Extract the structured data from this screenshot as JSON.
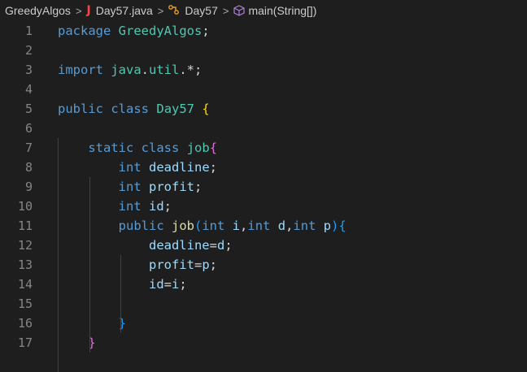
{
  "breadcrumb": {
    "items": [
      {
        "label": "GreedyAlgos",
        "icon": null
      },
      {
        "label": "Day57.java",
        "icon": "java-file-icon"
      },
      {
        "label": "Day57",
        "icon": "class-icon"
      },
      {
        "label": "main(String[])",
        "icon": "method-icon"
      }
    ],
    "separator": ">"
  },
  "colors": {
    "background": "#1e1e1e",
    "keyword": "#569cd6",
    "type": "#4ec9b0",
    "variable": "#9cdcfe",
    "function": "#dcdcaa",
    "bracket_gold": "#ffd700",
    "bracket_purple": "#da70d6",
    "bracket_blue": "#179fff"
  },
  "code": {
    "lines": [
      {
        "n": "1",
        "tokens": [
          [
            "kw",
            "package"
          ],
          [
            "pn",
            " "
          ],
          [
            "ty",
            "GreedyAlgos"
          ],
          [
            "pn",
            ";"
          ]
        ]
      },
      {
        "n": "2",
        "tokens": []
      },
      {
        "n": "3",
        "tokens": [
          [
            "kw",
            "import"
          ],
          [
            "pn",
            " "
          ],
          [
            "ty",
            "java"
          ],
          [
            "pn",
            "."
          ],
          [
            "ty",
            "util"
          ],
          [
            "pn",
            ".*;"
          ]
        ]
      },
      {
        "n": "4",
        "tokens": []
      },
      {
        "n": "5",
        "tokens": [
          [
            "kw",
            "public"
          ],
          [
            "pn",
            " "
          ],
          [
            "kw",
            "class"
          ],
          [
            "pn",
            " "
          ],
          [
            "ty",
            "Day57"
          ],
          [
            "pn",
            " "
          ],
          [
            "b1",
            "{"
          ]
        ]
      },
      {
        "n": "6",
        "tokens": []
      },
      {
        "n": "7",
        "tokens": [
          [
            "pn",
            "    "
          ],
          [
            "kw",
            "static"
          ],
          [
            "pn",
            " "
          ],
          [
            "kw",
            "class"
          ],
          [
            "pn",
            " "
          ],
          [
            "ty",
            "job"
          ],
          [
            "b2",
            "{"
          ]
        ]
      },
      {
        "n": "8",
        "tokens": [
          [
            "pn",
            "        "
          ],
          [
            "kw",
            "int"
          ],
          [
            "pn",
            " "
          ],
          [
            "id",
            "deadline"
          ],
          [
            "pn",
            ";"
          ]
        ]
      },
      {
        "n": "9",
        "tokens": [
          [
            "pn",
            "        "
          ],
          [
            "kw",
            "int"
          ],
          [
            "pn",
            " "
          ],
          [
            "id",
            "profit"
          ],
          [
            "pn",
            ";"
          ]
        ]
      },
      {
        "n": "10",
        "tokens": [
          [
            "pn",
            "        "
          ],
          [
            "kw",
            "int"
          ],
          [
            "pn",
            " "
          ],
          [
            "id",
            "id"
          ],
          [
            "pn",
            ";"
          ]
        ]
      },
      {
        "n": "11",
        "tokens": [
          [
            "pn",
            "        "
          ],
          [
            "kw",
            "public"
          ],
          [
            "pn",
            " "
          ],
          [
            "fn",
            "job"
          ],
          [
            "b3",
            "("
          ],
          [
            "kw",
            "int"
          ],
          [
            "pn",
            " "
          ],
          [
            "id",
            "i"
          ],
          [
            "pn",
            ","
          ],
          [
            "kw",
            "int"
          ],
          [
            "pn",
            " "
          ],
          [
            "id",
            "d"
          ],
          [
            "pn",
            ","
          ],
          [
            "kw",
            "int"
          ],
          [
            "pn",
            " "
          ],
          [
            "id",
            "p"
          ],
          [
            "b3",
            ")"
          ],
          [
            "b3",
            "{"
          ]
        ]
      },
      {
        "n": "12",
        "tokens": [
          [
            "pn",
            "            "
          ],
          [
            "id",
            "deadline"
          ],
          [
            "pn",
            "="
          ],
          [
            "id",
            "d"
          ],
          [
            "pn",
            ";"
          ]
        ]
      },
      {
        "n": "13",
        "tokens": [
          [
            "pn",
            "            "
          ],
          [
            "id",
            "profit"
          ],
          [
            "pn",
            "="
          ],
          [
            "id",
            "p"
          ],
          [
            "pn",
            ";"
          ]
        ]
      },
      {
        "n": "14",
        "tokens": [
          [
            "pn",
            "            "
          ],
          [
            "id",
            "id"
          ],
          [
            "pn",
            "="
          ],
          [
            "id",
            "i"
          ],
          [
            "pn",
            ";"
          ]
        ]
      },
      {
        "n": "15",
        "tokens": []
      },
      {
        "n": "16",
        "tokens": [
          [
            "pn",
            "        "
          ],
          [
            "b3",
            "}"
          ]
        ]
      },
      {
        "n": "17",
        "tokens": [
          [
            "pn",
            "    "
          ],
          [
            "b2",
            "}"
          ]
        ]
      }
    ]
  }
}
